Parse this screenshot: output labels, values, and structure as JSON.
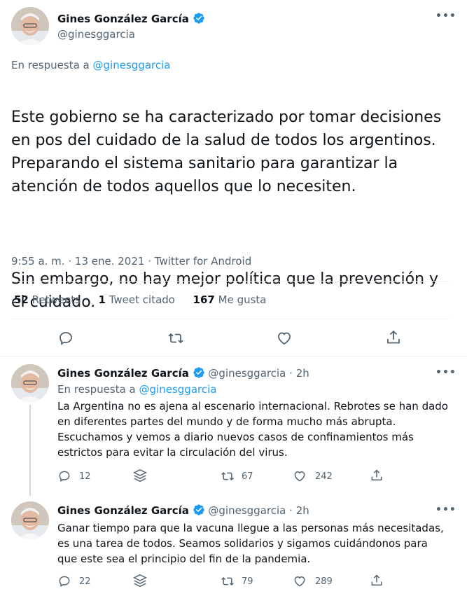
{
  "main_tweet": {
    "author_name": "Gines González García",
    "author_handle": "@ginesggarcia",
    "reply_prefix": "En respuesta a",
    "reply_to": "@ginesggarcia",
    "text_p1": "Este gobierno se ha caracterizado por tomar decisiones en pos del cuidado de la salud de todos los argentinos. Preparando el sistema sanitario para garantizar la atención de todos aquellos que lo necesiten.",
    "text_p2": "Sin embargo, no hay mejor política que la prevención y el cuidado.",
    "time": "9:55 a. m.",
    "date": "13 ene. 2021",
    "source": "Twitter for Android",
    "sep": "·",
    "stats": {
      "retweets_num": "52",
      "retweets_label": "Retweets",
      "quotes_num": "1",
      "quotes_label": "Tweet citado",
      "likes_num": "167",
      "likes_label": "Me gusta"
    },
    "icons": [
      "reply-icon",
      "retweet-icon",
      "like-icon",
      "share-icon"
    ]
  },
  "replies": [
    {
      "author_name": "Gines González García",
      "author_handle": "@ginesggarcia",
      "age": "2h",
      "sep": "·",
      "reply_prefix": "En respuesta a",
      "reply_to": "@ginesggarcia",
      "text": "La Argentina no es ajena al escenario internacional. Rebrotes se han dado en diferentes partes del mundo y de forma mucho más abrupta. Escuchamos y vemos a diario nuevos casos de confinamientos más estrictos para evitar la circulación del virus.",
      "replies_count": "12",
      "retweets_count": "67",
      "likes_count": "242"
    },
    {
      "author_name": "Gines González García",
      "author_handle": "@ginesggarcia",
      "age": "2h",
      "sep": "·",
      "text": "Ganar tiempo para que la vacuna llegue a las personas más necesitadas, es una tarea de todos. Seamos solidarios y sigamos cuidándonos para que este sea el principio del fin de la pandemia.",
      "replies_count": "22",
      "retweets_count": "79",
      "likes_count": "289"
    }
  ],
  "colors": {
    "accent": "#1d9bf0",
    "muted": "#536471",
    "text": "#0f1419",
    "divider": "#eff3f4"
  }
}
